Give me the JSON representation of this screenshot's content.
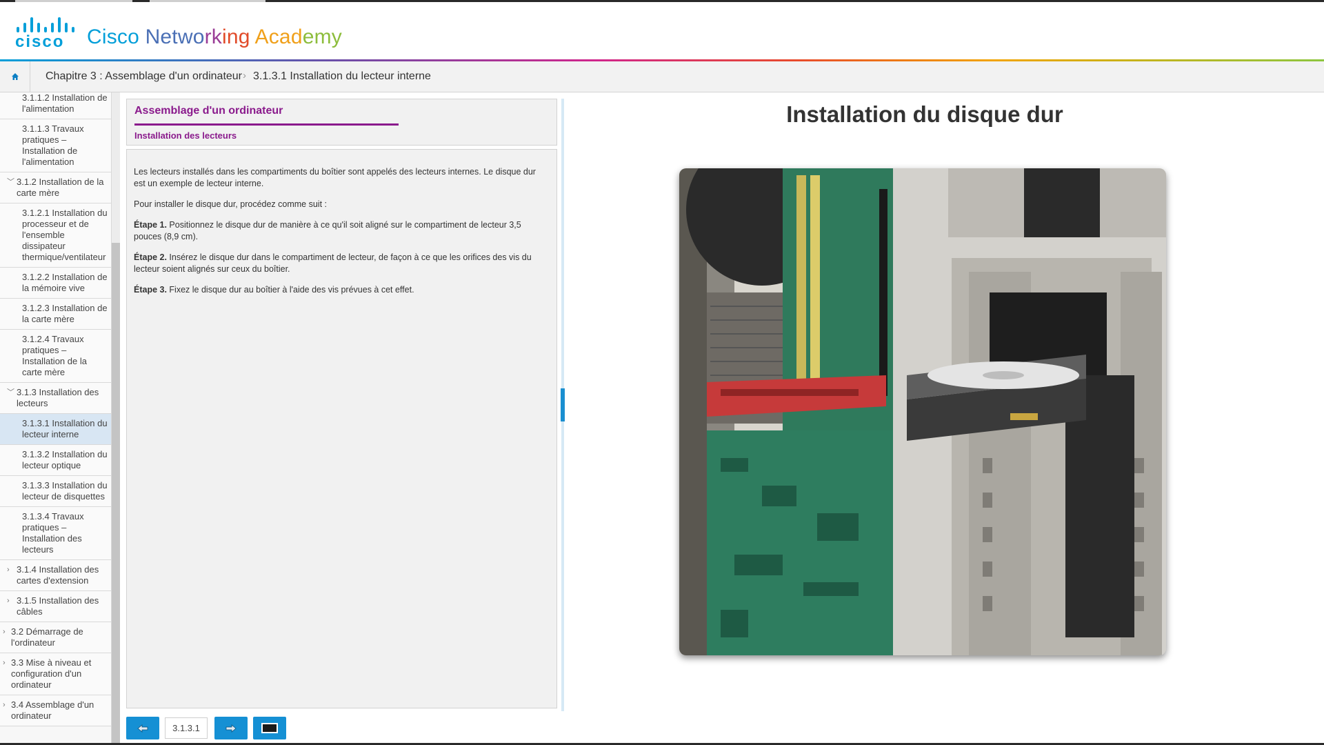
{
  "header": {
    "logo_word": "cisco",
    "title_parts": [
      {
        "text": "Cisco ",
        "color": "#049fd9"
      },
      {
        "text": "Netwo",
        "color": "#4a6fb5"
      },
      {
        "text": "rk",
        "color": "#9a3d97"
      },
      {
        "text": "ing",
        "color": "#e14b2a"
      },
      {
        "text": " Acad",
        "color": "#f0a01a"
      },
      {
        "text": "emy",
        "color": "#8dbd3c"
      }
    ]
  },
  "breadcrumb": {
    "home_icon": "home-icon",
    "chapter": "Chapitre 3 : Assemblage d'un ordinateur",
    "separator": "›",
    "current": "3.1.3.1 Installation du lecteur interne"
  },
  "sidebar": {
    "items": [
      {
        "level": 3,
        "label": "3.1.1.2 Installation de l'alimentation",
        "caret": "",
        "active": false
      },
      {
        "level": 3,
        "label": "3.1.1.3 Travaux pratiques – Installation de l'alimentation",
        "caret": "",
        "active": false
      },
      {
        "level": 2,
        "label": "3.1.2 Installation de la carte mère",
        "caret": "﹀",
        "active": false
      },
      {
        "level": 3,
        "label": "3.1.2.1 Installation du processeur et de l'ensemble dissipateur thermique/ventilateur",
        "caret": "",
        "active": false
      },
      {
        "level": 3,
        "label": "3.1.2.2 Installation de la mémoire vive",
        "caret": "",
        "active": false
      },
      {
        "level": 3,
        "label": "3.1.2.3 Installation de la carte mère",
        "caret": "",
        "active": false
      },
      {
        "level": 3,
        "label": "3.1.2.4 Travaux pratiques – Installation de la carte mère",
        "caret": "",
        "active": false
      },
      {
        "level": 2,
        "label": "3.1.3 Installation des lecteurs",
        "caret": "﹀",
        "active": false
      },
      {
        "level": 3,
        "label": "3.1.3.1 Installation du lecteur interne",
        "caret": "",
        "active": true
      },
      {
        "level": 3,
        "label": "3.1.3.2 Installation du lecteur optique",
        "caret": "",
        "active": false
      },
      {
        "level": 3,
        "label": "3.1.3.3 Installation du lecteur de disquettes",
        "caret": "",
        "active": false
      },
      {
        "level": 3,
        "label": "3.1.3.4 Travaux pratiques – Installation des lecteurs",
        "caret": "",
        "active": false
      },
      {
        "level": 2,
        "label": "3.1.4 Installation des cartes d'extension",
        "caret": "›",
        "active": false
      },
      {
        "level": 2,
        "label": "3.1.5 Installation des câbles",
        "caret": "›",
        "active": false
      },
      {
        "level": 1,
        "label": "3.2 Démarrage de l'ordinateur",
        "caret": "›",
        "active": false
      },
      {
        "level": 1,
        "label": "3.3 Mise à niveau et configuration d'un ordinateur",
        "caret": "›",
        "active": false
      },
      {
        "level": 1,
        "label": "3.4 Assemblage d'un ordinateur",
        "caret": "›",
        "active": false
      }
    ]
  },
  "panel": {
    "title": "Assemblage d'un ordinateur",
    "subtitle": "Installation des lecteurs",
    "intro": "Les lecteurs installés dans les compartiments du boîtier sont appelés des lecteurs internes. Le disque dur est un exemple de lecteur interne.",
    "lead": "Pour installer le disque dur, procédez comme suit :",
    "steps": [
      {
        "label": "Étape 1.",
        "text": "Positionnez le disque dur de manière à ce qu'il soit aligné sur le compartiment de lecteur 3,5 pouces (8,9 cm)."
      },
      {
        "label": "Étape 2.",
        "text": "Insérez le disque dur dans le compartiment de lecteur, de façon à ce que les orifices des vis du lecteur soient alignés sur ceux du boîtier."
      },
      {
        "label": "Étape 3.",
        "text": "Fixez le disque dur au boîtier à l'aide des vis prévues à cet effet."
      }
    ]
  },
  "nav": {
    "prev_icon": "arrow-left-icon",
    "page": "3.1.3.1",
    "next_icon": "arrow-right-icon",
    "media_icon": "screen-icon"
  },
  "content": {
    "heading": "Installation du disque dur",
    "image_icon": "hard-drive-installation-photo"
  },
  "colors": {
    "accent_blue": "#1590d4",
    "cisco_blue": "#049fd9",
    "purple": "#8a1a8c"
  }
}
